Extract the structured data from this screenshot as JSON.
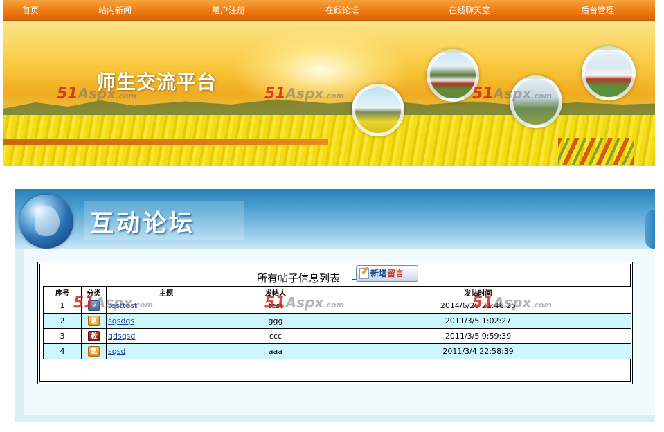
{
  "nav": {
    "items": [
      "首页",
      "站内新闻",
      "用户注册",
      "在线论坛",
      "在线聊天室",
      "后台管理"
    ]
  },
  "banner": {
    "title": "师生交流平台",
    "watermark_main": "51",
    "watermark_rest": "Aspx",
    "watermark_com": ".com"
  },
  "panel": {
    "title": "互动论坛"
  },
  "list": {
    "title": "所有帖子信息列表",
    "new_button_part1": "新增",
    "new_button_part2": "留言",
    "columns": [
      "序号",
      "分类",
      "主题",
      "发帖人",
      "发帖时间"
    ],
    "rows": [
      {
        "no": "1",
        "category_icon": "normal",
        "category_glyph": "↵",
        "subject": "testtest",
        "author": "test",
        "time": "2014/6/26 21:46:25"
      },
      {
        "no": "2",
        "category_icon": "urgent",
        "category_glyph": "急",
        "subject": "sqsdqs",
        "author": "ggg",
        "time": "2011/3/5 1:02:27"
      },
      {
        "no": "3",
        "category_icon": "help",
        "category_glyph": "救",
        "subject": "qdsqsd",
        "author": "ccc",
        "time": "2011/3/5 0:59:39"
      },
      {
        "no": "4",
        "category_icon": "urgent",
        "category_glyph": "急",
        "subject": "sqsd",
        "author": "aaa",
        "time": "2011/3/4 22:58:39"
      }
    ]
  },
  "colors": {
    "nav_orange": "#ee7a12",
    "row_highlight": "#cdf7fd",
    "link_blue": "#1f3f9f",
    "watermark_red": "#d2281e"
  }
}
